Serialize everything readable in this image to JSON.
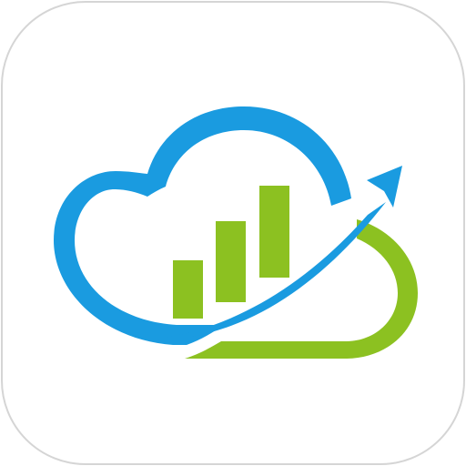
{
  "app_icon": {
    "icon": "cloud-analytics-growth-icon",
    "colors": {
      "background": "#ffffff",
      "frame_border": "#d5d5d5",
      "cloud_blue": "#1a9be0",
      "growth_green": "#8cc121"
    },
    "bars": {
      "count": 3,
      "relative_heights": [
        0.45,
        0.7,
        1.0
      ]
    }
  }
}
